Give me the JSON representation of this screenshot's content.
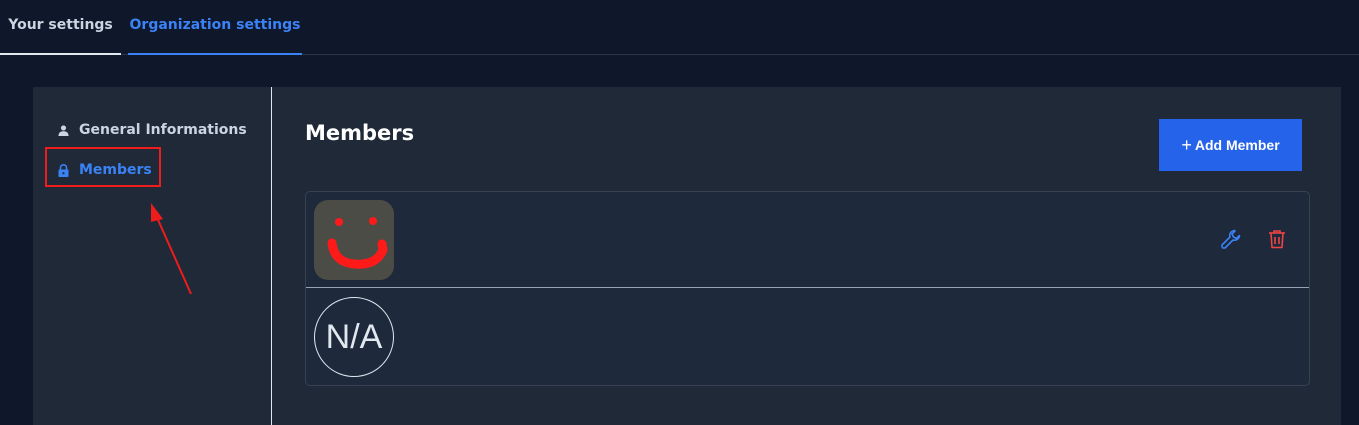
{
  "tabs": [
    {
      "label": "Your settings",
      "active": false
    },
    {
      "label": "Organization settings",
      "active": true
    }
  ],
  "sidebar": {
    "items": [
      {
        "label": "General Informations",
        "icon": "user-icon",
        "active": false
      },
      {
        "label": "Members",
        "icon": "lock-icon",
        "active": true
      }
    ]
  },
  "main": {
    "title": "Members",
    "add_button_label": "Add Member",
    "add_button_icon": "plus-icon",
    "members": [
      {
        "avatar": "smiley-avatar",
        "actions": [
          "wrench-icon",
          "trash-icon"
        ]
      },
      {
        "avatar_text": "N/A"
      }
    ]
  },
  "colors": {
    "background": "#0f172a",
    "panel": "#1f2937",
    "accent": "#3b82f6",
    "button": "#2563eb",
    "danger": "#ef4444",
    "annotation": "#ef1c1c"
  }
}
